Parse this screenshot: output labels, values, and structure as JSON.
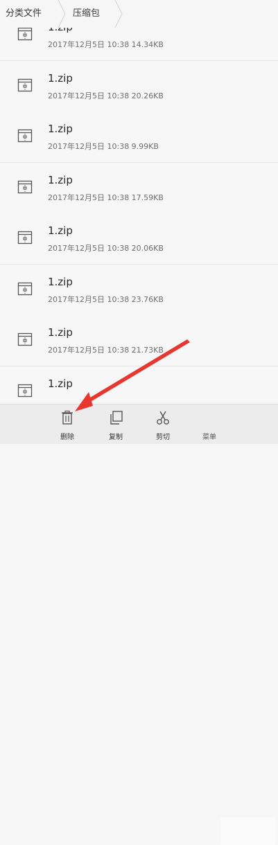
{
  "breadcrumb": [
    "分类文件",
    "压缩包"
  ],
  "files": [
    {
      "name": "1.zip",
      "meta": "2017年12月5日 10:38 14.34KB"
    },
    {
      "name": "1.zip",
      "meta": "2017年12月5日 10:38 20.26KB"
    },
    {
      "name": "1.zip",
      "meta": "2017年12月5日 10:38 9.99KB"
    },
    {
      "name": "1.zip",
      "meta": "2017年12月5日 10:38 17.59KB"
    },
    {
      "name": "1.zip",
      "meta": "2017年12月5日 10:38 20.06KB"
    },
    {
      "name": "1.zip",
      "meta": "2017年12月5日 10:38 23.76KB"
    },
    {
      "name": "1.zip",
      "meta": "2017年12月5日 10:38 21.73KB"
    },
    {
      "name": "1.zip",
      "meta": ""
    }
  ],
  "toolbar": {
    "delete_label": "删除",
    "copy_label": "复制",
    "cut_label": "剪切",
    "more_label": "菜单"
  },
  "icons": {
    "file": "zip-file-icon",
    "delete": "trash-icon",
    "copy": "copy-icon",
    "cut": "scissors-icon"
  },
  "colors": {
    "annotation_arrow": "#e8372f"
  }
}
